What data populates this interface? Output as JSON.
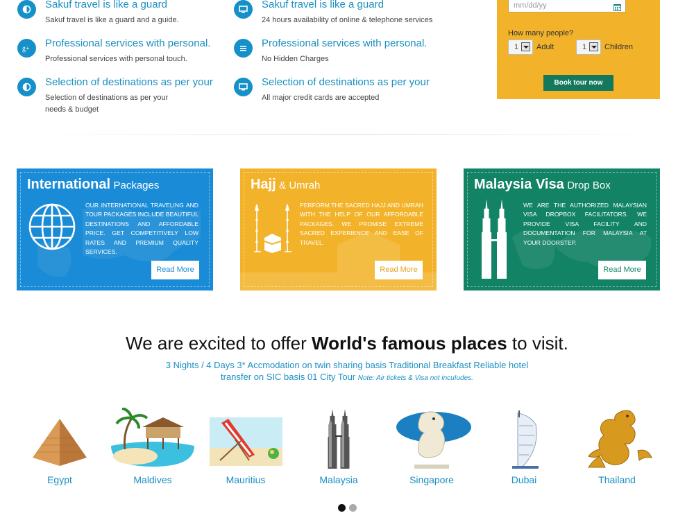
{
  "features": [
    {
      "icon": "half-circle-icon",
      "title": "Sakuf travel is like a guard",
      "desc": "Sakuf travel is like a guard and a guide."
    },
    {
      "icon": "monitor-icon",
      "title": "Sakuf travel is like a guard",
      "desc": "24 hours availability of online & telephone services"
    },
    {
      "icon": "google-plus-icon",
      "title": "Professional services with personal.",
      "desc": "Professional services with personal touch."
    },
    {
      "icon": "list-icon",
      "title": "Professional services with personal.",
      "desc": "No Hidden Charges"
    },
    {
      "icon": "half-circle-icon",
      "title": "Selection of destinations as per your",
      "desc": "Selection of destinations as per your needs & budget"
    },
    {
      "icon": "monitor-icon",
      "title": "Selection of destinations as per your",
      "desc": "All major credit cards are accepted"
    }
  ],
  "booking": {
    "date_placeholder": "mm/dd/yy",
    "people_label": "How many people?",
    "adult_value": "1",
    "adult_label": "Adult",
    "children_value": "1",
    "children_label": "Children",
    "book_button": "Book tour now",
    "color": "#f2b32a",
    "button_color": "#14785c"
  },
  "cards": [
    {
      "title_bold": "International",
      "title_rest": "Packages",
      "text": "Our international traveling and tour packages include beautiful destinations and affordable price. Get competitively low rates and premium quality services.",
      "button": "Read More",
      "color": "#1a8bd6"
    },
    {
      "title_bold": "Hajj",
      "title_rest": "& Umrah",
      "text": "Perform the sacred Hajj and Umrah with the help of our affordable packages. We promise extreme sacred experience and ease of travel.",
      "button": "Read More",
      "color": "#f2b32a"
    },
    {
      "title_bold": "Malaysia Visa",
      "title_rest": "Drop Box",
      "text": "We are the authorized Malaysian visa dropbox facilitators. We provide visa facility and documentation for Malaysia at your doorstep.",
      "button": "Read More",
      "color": "#138365"
    }
  ],
  "offer": {
    "heading_pre": "We are excited to offer",
    "heading_bold": "World's famous places",
    "heading_post": "to visit.",
    "line1": "3 Nights / 4 Days 3* Accmodation on twin sharing basis Traditional Breakfast Reliable hotel",
    "line2": "transfer on SIC basis 01 City Tour",
    "note": "Note: Air tickets & Visa not incuIudes."
  },
  "places": [
    "Egypt",
    "Maldives",
    "Mauritius",
    "Malaysia",
    "Singapore",
    "Dubai",
    "Thailand"
  ],
  "accent_color": "#1a8fc2"
}
